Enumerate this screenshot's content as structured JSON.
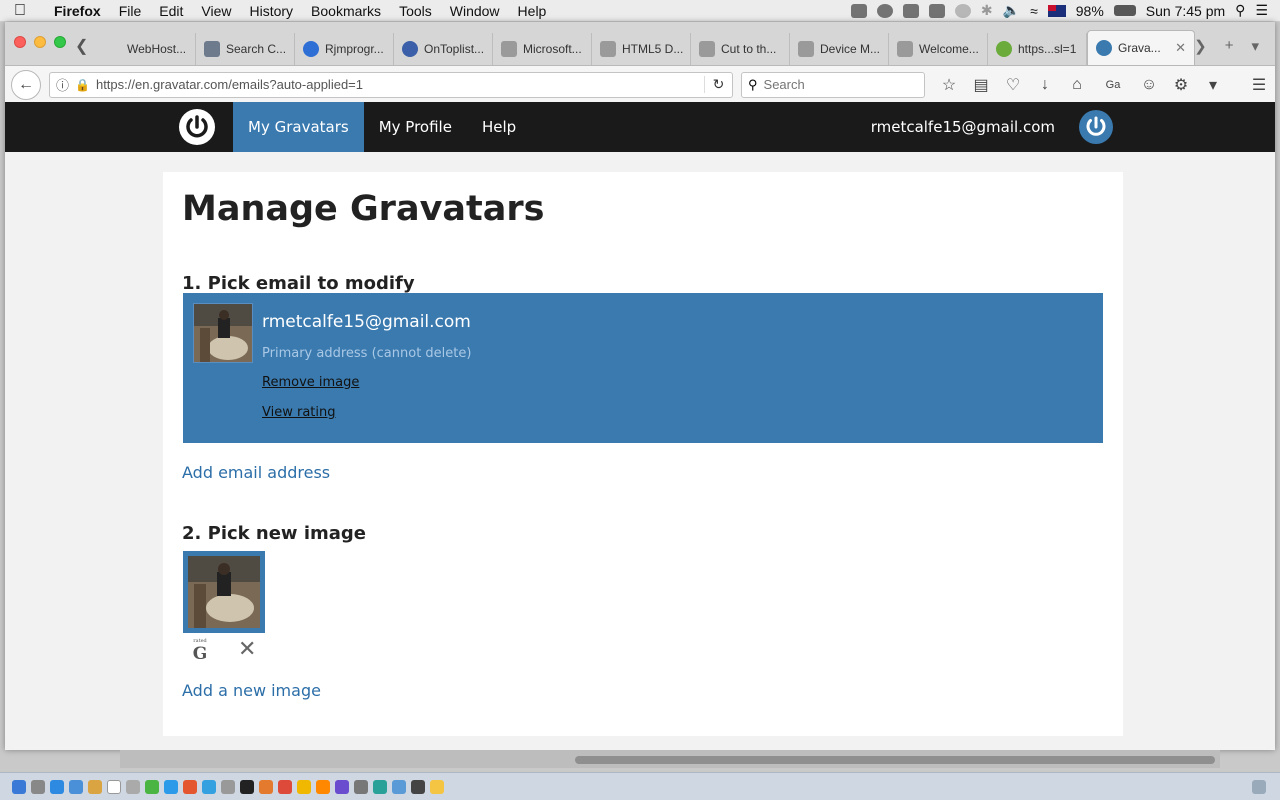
{
  "menubar": {
    "app_name": "Firefox",
    "menus": [
      "File",
      "Edit",
      "View",
      "History",
      "Bookmarks",
      "Tools",
      "Window",
      "Help"
    ],
    "battery": "98%",
    "clock": "Sun 7:45 pm"
  },
  "tabs": [
    {
      "title": "WebHost..."
    },
    {
      "title": "Search C..."
    },
    {
      "title": "Rjmprogr..."
    },
    {
      "title": "OnToplist..."
    },
    {
      "title": "Microsoft..."
    },
    {
      "title": "HTML5 D..."
    },
    {
      "title": "Cut to th..."
    },
    {
      "title": "Device M..."
    },
    {
      "title": "Welcome..."
    },
    {
      "title": "https...sl=1"
    },
    {
      "title": "Grava...",
      "active": true
    }
  ],
  "navbar": {
    "url": "https://en.gravatar.com/emails?auto-applied=1",
    "search_placeholder": "Search",
    "search_engine_label": "Ga"
  },
  "site": {
    "nav": [
      {
        "label": "My Gravatars",
        "active": true
      },
      {
        "label": "My Profile"
      },
      {
        "label": "Help"
      }
    ],
    "user_email": "rmetcalfe15@gmail.com",
    "accent": "#3a7aaf"
  },
  "page": {
    "title": "Manage Gravatars",
    "step1_heading": "1. Pick email to modify",
    "email": {
      "address": "rmetcalfe15@gmail.com",
      "note": "Primary address (cannot delete)",
      "remove_label": "Remove image",
      "rating_label": "View rating"
    },
    "add_email_label": "Add email address",
    "step2_heading": "2. Pick new image",
    "rating_small": "rated",
    "rating_letter": "G",
    "add_image_label": "Add a new image"
  }
}
